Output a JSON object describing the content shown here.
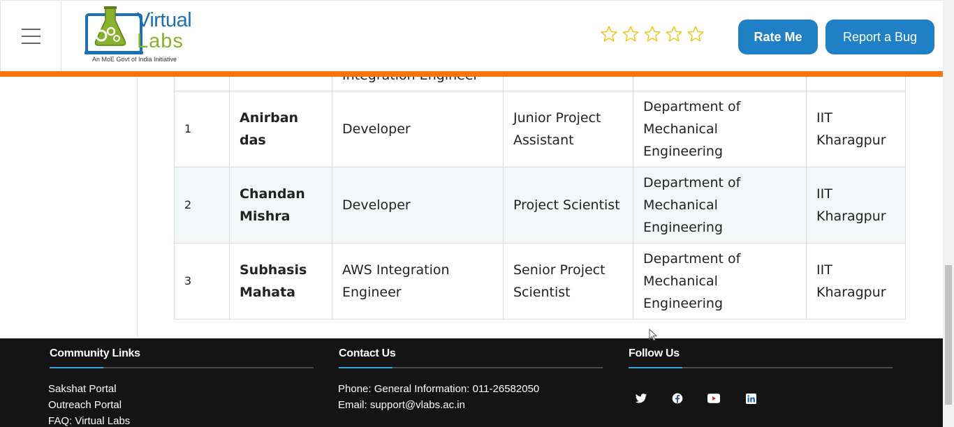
{
  "header": {
    "logo": {
      "word1": "Virtual",
      "word2": "Labs",
      "tagline": "An MoE Govt of India Initiative"
    },
    "rating": {
      "stars_total": 5,
      "stars_filled": 0,
      "star_color": "#f0c419"
    },
    "rate_button": "Rate Me",
    "bug_button": "Report a Bug",
    "accent_bar_color": "#f6750c",
    "button_color": "#2080c6"
  },
  "table": {
    "partial_row": {
      "col3": "Integration Engineer"
    },
    "rows": [
      {
        "num": "1",
        "name": "Anirban das",
        "role": "Developer",
        "designation": "Junior Project Assistant",
        "department": "Department of Mechanical Engineering",
        "institute": "IIT Kharagpur"
      },
      {
        "num": "2",
        "name": "Chandan Mishra",
        "role": "Developer",
        "designation": "Project Scientist",
        "department": "Department of Mechanical Engineering",
        "institute": "IIT Kharagpur"
      },
      {
        "num": "3",
        "name": "Subhasis Mahata",
        "role": "AWS Integration Engineer",
        "designation": "Senior Project Scientist",
        "department": "Department of Mechanical Engineering",
        "institute": "IIT Kharagpur"
      }
    ]
  },
  "footer": {
    "community": {
      "title": "Community Links",
      "links": [
        "Sakshat Portal",
        "Outreach Portal",
        "FAQ: Virtual Labs"
      ]
    },
    "contact": {
      "title": "Contact Us",
      "phone": "Phone: General Information: 011-26582050",
      "email": "Email: support@vlabs.ac.in"
    },
    "follow": {
      "title": "Follow Us",
      "icons": [
        {
          "name": "twitter-icon",
          "color": "#4aa1eb"
        },
        {
          "name": "facebook-icon",
          "color": "#3b5998"
        },
        {
          "name": "youtube-icon",
          "color": "#e62117"
        },
        {
          "name": "linkedin-icon",
          "color": "#1b66ac"
        }
      ]
    }
  }
}
